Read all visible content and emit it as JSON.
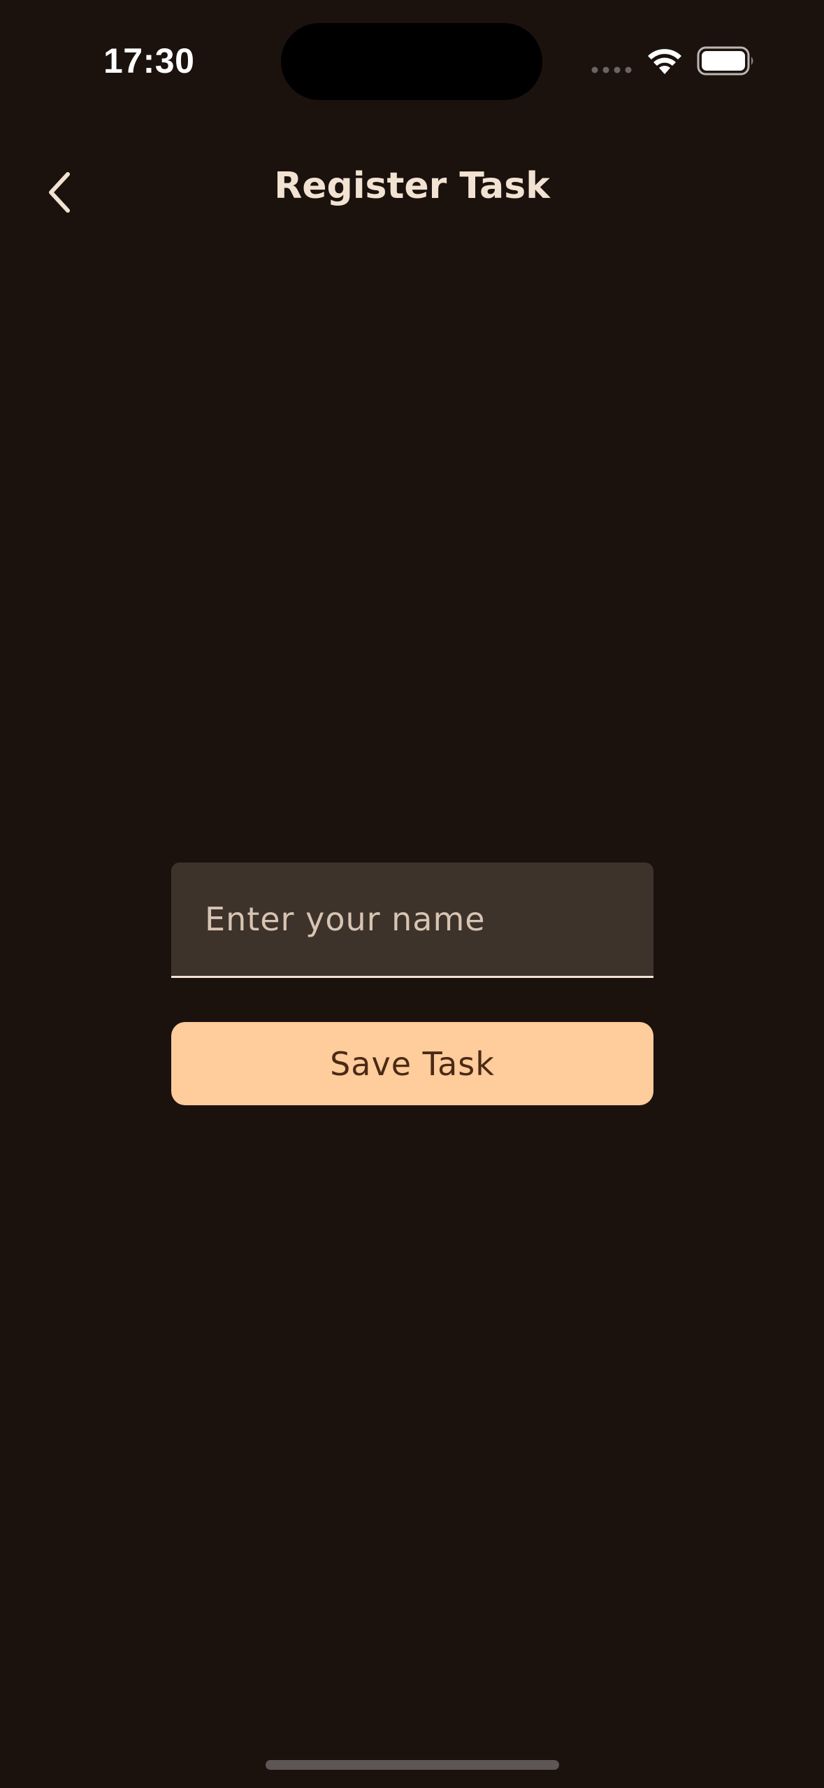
{
  "status_bar": {
    "time": "17:30"
  },
  "nav": {
    "title": "Register Task",
    "back_icon": "chevron-left-icon"
  },
  "form": {
    "name_placeholder": "Enter your name",
    "name_value": "",
    "save_label": "Save Task"
  },
  "colors": {
    "background": "#1b120e",
    "title_text": "#f2e2d2",
    "field_background": "#3e332b",
    "button_background": "#ffcc9c",
    "button_text": "#4a2a14"
  }
}
